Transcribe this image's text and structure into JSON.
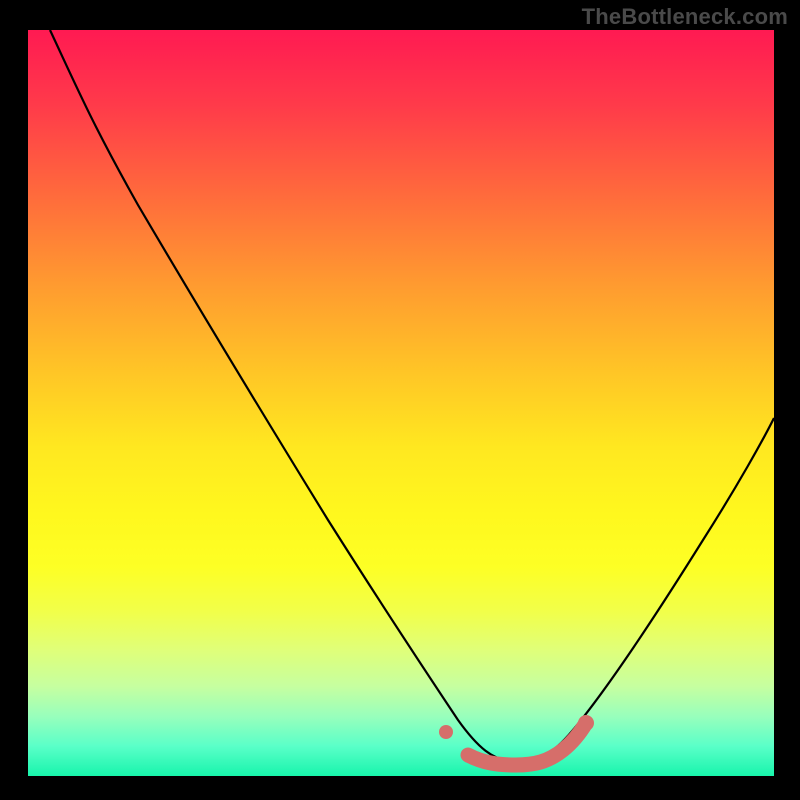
{
  "attribution": "TheBottleneck.com",
  "chart_data": {
    "type": "line",
    "title": "",
    "xlabel": "",
    "ylabel": "",
    "xlim": [
      0,
      100
    ],
    "ylim": [
      0,
      100
    ],
    "curve": {
      "name": "bottleneck-curve",
      "color": "#000000",
      "points": [
        {
          "x": 3,
          "y": 100
        },
        {
          "x": 10,
          "y": 84
        },
        {
          "x": 20,
          "y": 65
        },
        {
          "x": 30,
          "y": 48
        },
        {
          "x": 40,
          "y": 32
        },
        {
          "x": 50,
          "y": 16
        },
        {
          "x": 56,
          "y": 7
        },
        {
          "x": 60,
          "y": 3
        },
        {
          "x": 64,
          "y": 1.5
        },
        {
          "x": 68,
          "y": 1.5
        },
        {
          "x": 72,
          "y": 3
        },
        {
          "x": 78,
          "y": 9
        },
        {
          "x": 86,
          "y": 22
        },
        {
          "x": 94,
          "y": 38
        },
        {
          "x": 100,
          "y": 51
        }
      ]
    },
    "highlight_range": {
      "color": "#d66e6a",
      "x_start": 56,
      "x_end": 74,
      "segments": [
        {
          "x": 56,
          "y": 7,
          "isolated": true
        },
        {
          "x": 60,
          "y": 3
        },
        {
          "x": 64,
          "y": 1.5
        },
        {
          "x": 68,
          "y": 1.5
        },
        {
          "x": 72,
          "y": 3
        },
        {
          "x": 74,
          "y": 4.5
        }
      ]
    },
    "gradient": {
      "top_color": "#ff1a52",
      "bottom_color": "#18f5ac",
      "stops": [
        "red",
        "orange",
        "yellow",
        "green"
      ]
    }
  }
}
